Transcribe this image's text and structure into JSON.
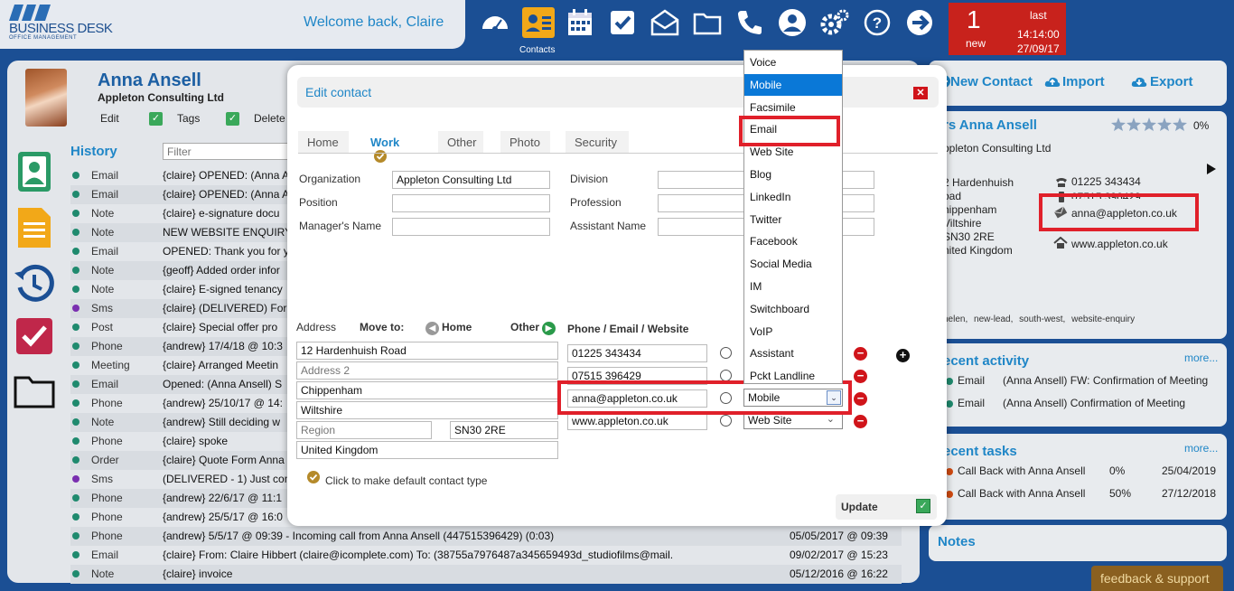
{
  "topbar": {
    "logo_text": "BUSINESS DESK",
    "logo_sub": "OFFICE MANAGEMENT",
    "welcome": "Welcome back, Claire",
    "contacts_label": "Contacts",
    "icons": [
      "dashboard-icon",
      "contacts-icon",
      "calendar-icon",
      "tasks-icon",
      "mail-icon",
      "folder-icon",
      "phone-icon",
      "user-icon",
      "settings-icon",
      "help-icon",
      "logout-icon"
    ],
    "notification": {
      "count": "1",
      "new_label": "new",
      "last_label": "last",
      "time": "14:14:00",
      "date": "27/09/17"
    }
  },
  "contact": {
    "name": "Anna Ansell",
    "company": "Appleton Consulting Ltd",
    "actions": [
      "Edit",
      "Tags",
      "Delete"
    ]
  },
  "history": {
    "title": "History",
    "filter_placeholder": "Filter",
    "rows": [
      {
        "type": "Email",
        "color": "#1f8a6e",
        "desc": "{claire} OPENED: (Anna A",
        "date": ""
      },
      {
        "type": "Email",
        "color": "#1f8a6e",
        "desc": "{claire} OPENED: (Anna A",
        "date": ""
      },
      {
        "type": "Note",
        "color": "#1f8a6e",
        "desc": "{claire} e-signature docu",
        "date": ""
      },
      {
        "type": "Note",
        "color": "#1f8a6e",
        "desc": "NEW WEBSITE ENQUIRY",
        "date": ""
      },
      {
        "type": "Email",
        "color": "#1f8a6e",
        "desc": "OPENED: Thank you for y",
        "date": ""
      },
      {
        "type": "Note",
        "color": "#1f8a6e",
        "desc": "{geoff} Added order infor",
        "date": ""
      },
      {
        "type": "Note",
        "color": "#1f8a6e",
        "desc": "{claire} E-signed tenancy",
        "date": ""
      },
      {
        "type": "Sms",
        "color": "#7a2fb0",
        "desc": "{claire} (DELIVERED) For",
        "date": ""
      },
      {
        "type": "Post",
        "color": "#1f8a6e",
        "desc": "{claire} Special offer pro",
        "date": ""
      },
      {
        "type": "Phone",
        "color": "#1f8a6e",
        "desc": "{andrew} 17/4/18 @ 10:3",
        "date": ""
      },
      {
        "type": "Meeting",
        "color": "#1f8a6e",
        "desc": "{claire} Arranged Meetin",
        "date": ""
      },
      {
        "type": "Email",
        "color": "#1f8a6e",
        "desc": "Opened: (Anna Ansell) S",
        "date": ""
      },
      {
        "type": "Phone",
        "color": "#1f8a6e",
        "desc": "{andrew} 25/10/17 @ 14:",
        "date": ""
      },
      {
        "type": "Note",
        "color": "#1f8a6e",
        "desc": "{andrew} Still deciding w",
        "date": ""
      },
      {
        "type": "Phone",
        "color": "#1f8a6e",
        "desc": "{claire} spoke",
        "date": ""
      },
      {
        "type": "Order",
        "color": "#1f8a6e",
        "desc": "{claire} Quote Form Anna",
        "date": ""
      },
      {
        "type": "Sms",
        "color": "#7a2fb0",
        "desc": "(DELIVERED - 1) Just con",
        "date": ""
      },
      {
        "type": "Phone",
        "color": "#1f8a6e",
        "desc": "{andrew} 22/6/17 @ 11:1",
        "date": ""
      },
      {
        "type": "Phone",
        "color": "#1f8a6e",
        "desc": "{andrew} 25/5/17 @ 16:0",
        "date": ""
      },
      {
        "type": "Phone",
        "color": "#1f8a6e",
        "desc": "{andrew} 5/5/17 @ 09:39 - Incoming call from Anna Ansell (447515396429) (0:03)",
        "date": "05/05/2017 @ 09:39"
      },
      {
        "type": "Email",
        "color": "#1f8a6e",
        "desc": "{claire} From: Claire Hibbert (claire@icomplete.com) To: (38755a7976487a345659493d_studiofilms@mail.",
        "date": "09/02/2017 @ 15:23"
      },
      {
        "type": "Note",
        "color": "#1f8a6e",
        "desc": "{claire} invoice",
        "date": "05/12/2016 @ 16:22"
      }
    ]
  },
  "right": {
    "new_contact": "New Contact",
    "import": "Import",
    "export": "Export",
    "card_name": "rs Anna Ansell",
    "rating_pct": "0%",
    "rating_value": 0,
    "card_company": "ppleton Consulting Ltd",
    "address_lines": [
      "2 Hardenhuish",
      "oad",
      "hippenham",
      "Viltshire",
      "SN30 2RE",
      "nited Kingdom"
    ],
    "phone1": "01225 343434",
    "phone2": "07515 396429",
    "email": "anna@appleton.co.uk",
    "website": "www.appleton.co.uk",
    "tags": [
      "helen,",
      "new-lead,",
      "south-west,",
      "website-enquiry"
    ],
    "activity_title": "ecent activity",
    "activity_more": "more...",
    "activity": [
      {
        "type": "Email",
        "desc": "(Anna Ansell) FW: Confirmation of Meeting"
      },
      {
        "type": "Email",
        "desc": "(Anna Ansell) Confirmation of Meeting"
      }
    ],
    "tasks_title": "ecent tasks",
    "tasks_more": "more...",
    "tasks": [
      {
        "desc": "Call Back with Anna Ansell",
        "pct": "0%",
        "date": "25/04/2019"
      },
      {
        "desc": "Call Back with Anna Ansell",
        "pct": "50%",
        "date": "27/12/2018"
      }
    ],
    "notes_title": "Notes",
    "feedback": "feedback & support"
  },
  "modal": {
    "title": "Edit contact",
    "tabs": [
      "Home",
      "Work",
      "Other",
      "Photo",
      "Security"
    ],
    "active_tab": "Work",
    "fields": {
      "organization_label": "Organization",
      "organization": "Appleton Consulting Ltd",
      "position_label": "Position",
      "position": "",
      "manager_label": "Manager's Name",
      "manager": "",
      "division_label": "Division",
      "division": "",
      "profession_label": "Profession",
      "profession": "",
      "assistant_label": "Assistant Name",
      "assistant": ""
    },
    "address": {
      "label": "Address",
      "move_to": "Move to:",
      "home": "Home",
      "other": "Other",
      "line1": "12 Hardenhuish Road",
      "line2_placeholder": "Address 2",
      "city": "Chippenham",
      "county": "Wiltshire",
      "region_placeholder": "Region",
      "postcode": "SN30 2RE",
      "country": "United Kingdom"
    },
    "pew": {
      "label": "Phone / Email / Website",
      "rows": [
        {
          "value": "01225 343434",
          "type": ""
        },
        {
          "value": "07515 396429",
          "type": ""
        },
        {
          "value": "anna@appleton.co.uk",
          "type": "Mobile"
        },
        {
          "value": "www.appleton.co.uk",
          "type": "Web Site"
        }
      ]
    },
    "default_note": "Click to make default contact type",
    "update": "Update"
  },
  "dropdown": {
    "options": [
      "Voice",
      "Mobile",
      "Facsimile",
      "Email",
      "Web Site",
      "Blog",
      "LinkedIn",
      "Twitter",
      "Facebook",
      "Social Media",
      "IM",
      "Switchboard",
      "VoIP",
      "Assistant",
      "Pckt Landline"
    ],
    "selected": "Mobile",
    "highlighted": "Email"
  }
}
